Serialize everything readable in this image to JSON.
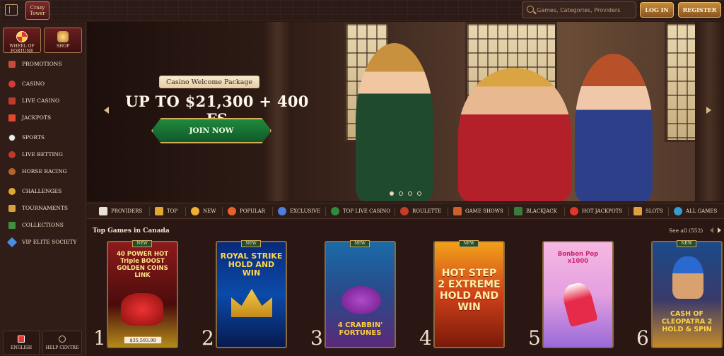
{
  "header": {
    "logo_text": "Crazy Tower",
    "search_placeholder": "Games, Categories, Providers",
    "login_label": "LOG IN",
    "register_label": "REGISTER"
  },
  "sidebar": {
    "quick_links": [
      {
        "label": "WHEEL OF FORTUNE",
        "icon": "wheel-icon"
      },
      {
        "label": "SHOP",
        "icon": "shop-icon"
      }
    ],
    "items": [
      {
        "label": "PROMOTIONS",
        "icon": "gift-icon"
      },
      {
        "label": "CASINO",
        "icon": "cherry-icon"
      },
      {
        "label": "LIVE CASINO",
        "icon": "live-casino-icon"
      },
      {
        "label": "JACKPOTS",
        "icon": "seven-icon"
      },
      {
        "label": "SPORTS",
        "icon": "soccer-ball-icon"
      },
      {
        "label": "LIVE BETTING",
        "icon": "live-icon"
      },
      {
        "label": "HORSE RACING",
        "icon": "horse-icon"
      },
      {
        "label": "CHALLENGES",
        "icon": "coin-icon"
      },
      {
        "label": "TOURNAMENTS",
        "icon": "trophy-icon"
      },
      {
        "label": "COLLECTIONS",
        "icon": "book-icon"
      },
      {
        "label": "VIP ELITE SOCIETY",
        "icon": "diamond-icon"
      }
    ],
    "footer": {
      "language_label": "ENGLISH",
      "help_label": "HELP CENTRE"
    }
  },
  "banner": {
    "tag": "Casino Welcome Package",
    "headline": "UP TO $21,300 + 400 FS",
    "cta_label": "JOIN NOW",
    "slides": 4,
    "active_slide": 1
  },
  "categories": [
    {
      "label": "PROVIDERS",
      "icon": "cards-icon"
    },
    {
      "label": "TOP",
      "icon": "crown-icon"
    },
    {
      "label": "NEW",
      "icon": "lightning-icon"
    },
    {
      "label": "POPULAR",
      "icon": "fire-icon"
    },
    {
      "label": "EXCLUSIVE",
      "icon": "gem-icon"
    },
    {
      "label": "TOP LIVE CASINO",
      "icon": "chip-icon"
    },
    {
      "label": "ROULETTE",
      "icon": "roulette-icon"
    },
    {
      "label": "GAME SHOWS",
      "icon": "microphone-icon"
    },
    {
      "label": "BLACKJACK",
      "icon": "blackjack-icon"
    },
    {
      "label": "HOT JACKPOTS",
      "icon": "chili-icon"
    },
    {
      "label": "SLOTS",
      "icon": "slot-icon"
    },
    {
      "label": "ALL GAMES",
      "icon": "globe-icon"
    }
  ],
  "top_games": {
    "title": "Top Games in Canada",
    "see_all_label": "See all (552)",
    "games": [
      {
        "rank": "1",
        "title": "40 POWER HOT Triple BOOST GOLDEN COINS LINK",
        "badge": "NEW",
        "jackpot": "$35,593.98"
      },
      {
        "rank": "2",
        "title": "ROYAL STRIKE HOLD AND WIN",
        "badge": "NEW",
        "jackpot": ""
      },
      {
        "rank": "3",
        "title": "4 CRABBIN' FORTUNES",
        "badge": "NEW",
        "jackpot": ""
      },
      {
        "rank": "4",
        "title": "HOT STEP 2 EXTREME HOLD AND WIN",
        "badge": "NEW",
        "jackpot": ""
      },
      {
        "rank": "5",
        "title": "Bonbon Pop x1000",
        "badge": "",
        "jackpot": ""
      },
      {
        "rank": "6",
        "title": "CASH OF CLEOPATRA 2 HOLD & SPIN",
        "badge": "NEW",
        "jackpot": ""
      }
    ]
  },
  "colors": {
    "background": "#2a1714",
    "gold": "#c58b3a",
    "green_cta": "#1e8a3c"
  }
}
